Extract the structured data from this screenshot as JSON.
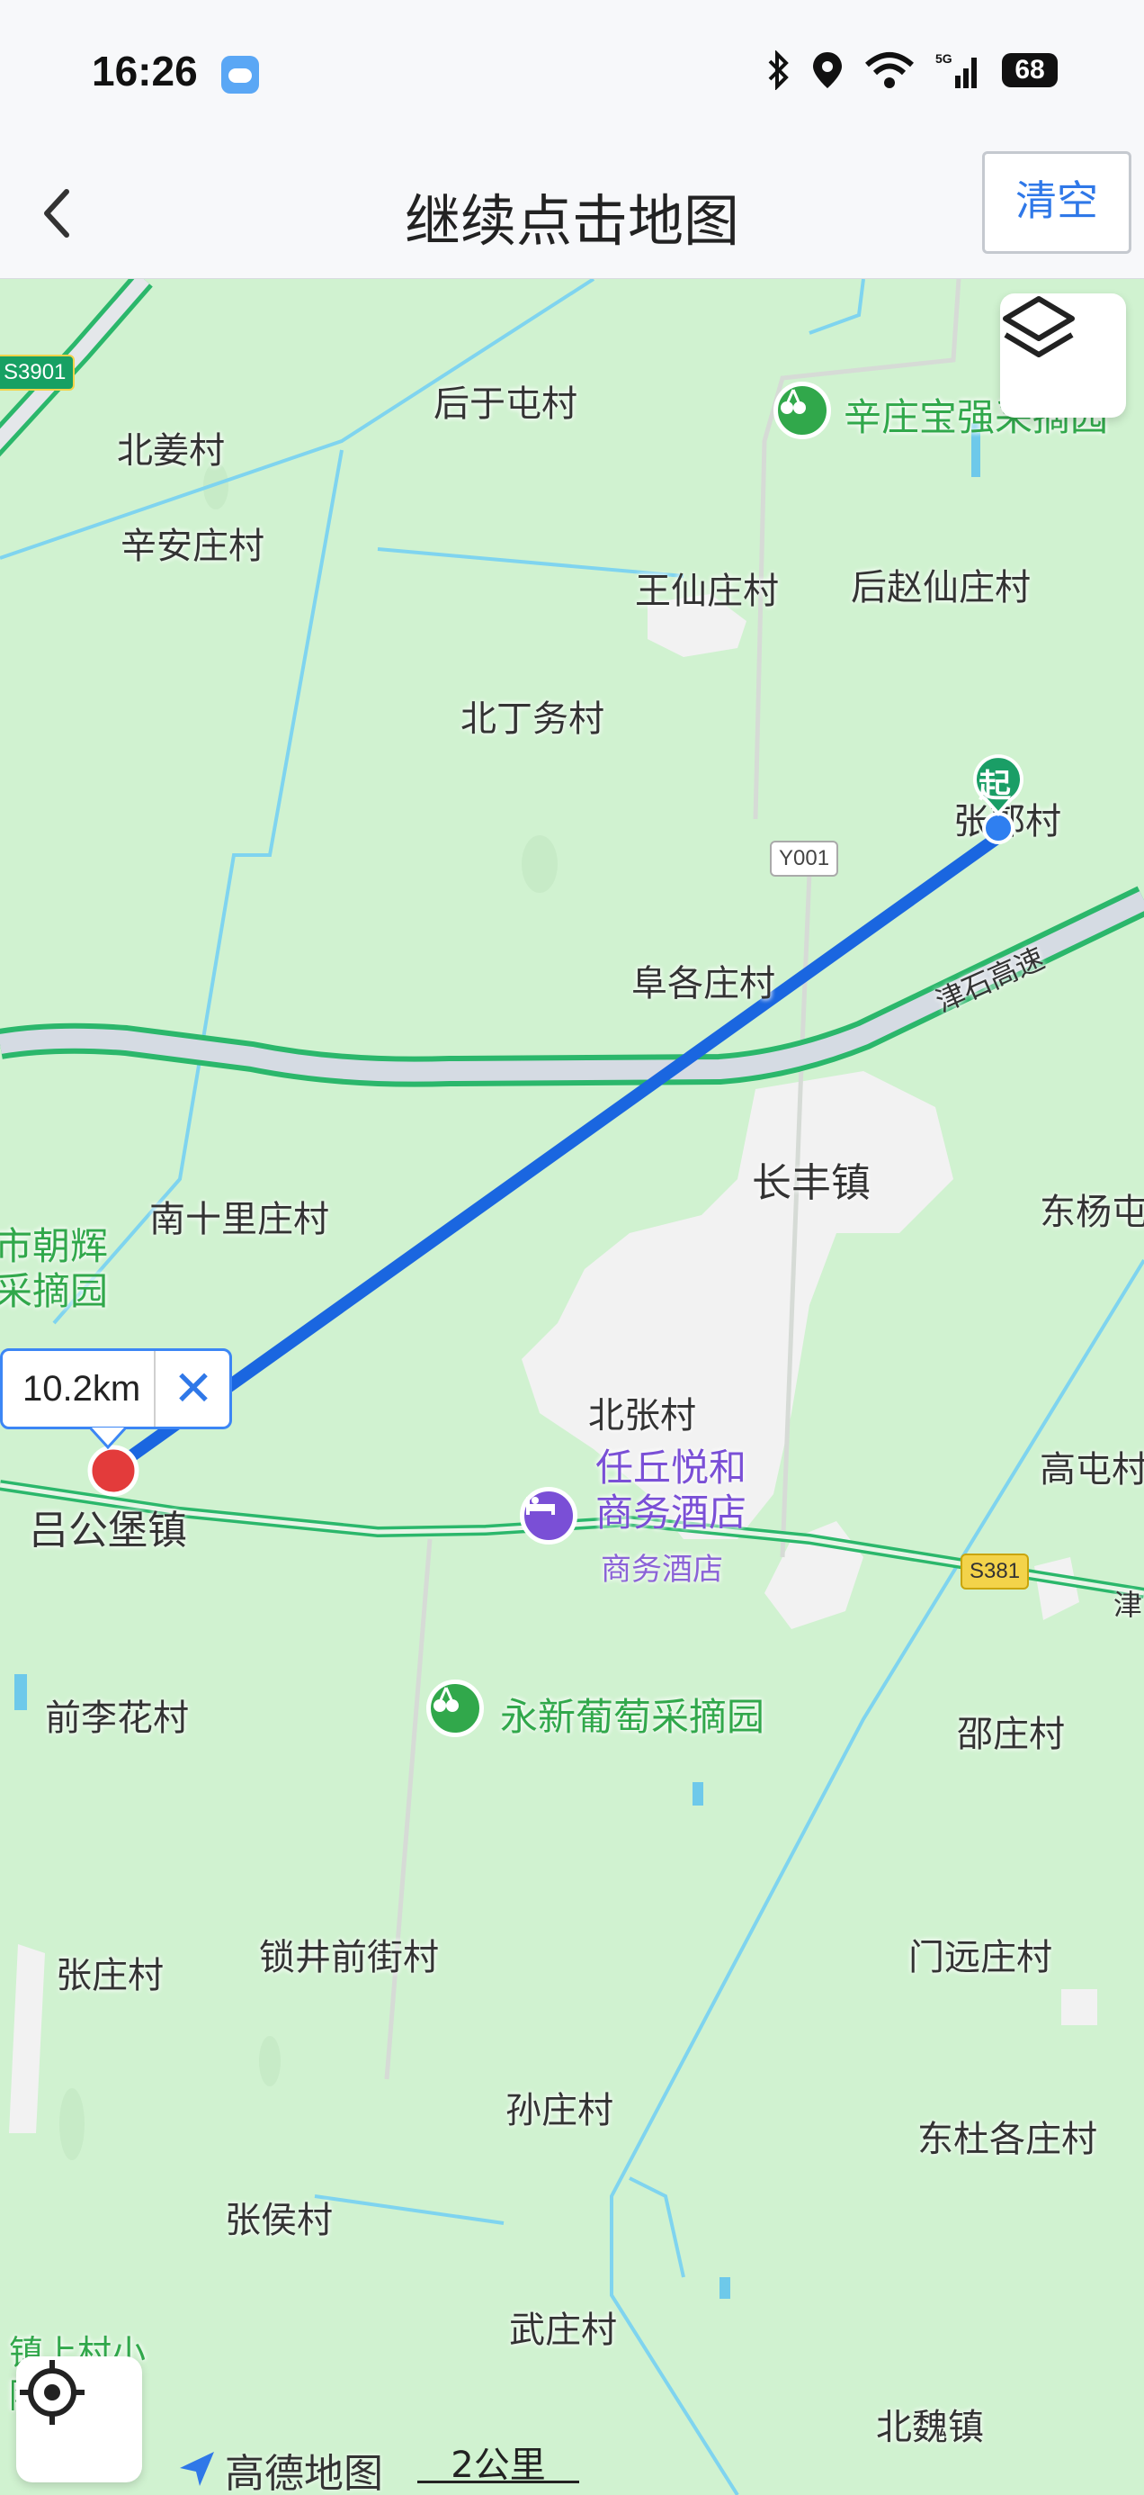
{
  "status_bar": {
    "time": "16:26",
    "battery": "68",
    "network": "5G"
  },
  "header": {
    "title": "继续点击地图",
    "clear_label": "清空"
  },
  "map": {
    "labels": {
      "houyutun": "后于屯村",
      "beijiang": "北姜村",
      "xinanzhuang": "辛安庄村",
      "xinzhuang_poi": "辛庄宝强采摘园",
      "wangxianzhuang": "王仙庄村",
      "houzhaoxianzhuang": "后赵仙庄村",
      "beidingwu": "北丁务村",
      "zhangzhuang_top": "张郭村",
      "fugezhuang": "阜各庄村",
      "changfeng": "长丰镇",
      "nanshilizhuang": "南十里庄村",
      "chaohui": "市朝辉\n采摘园",
      "dongyang": "东杨屯",
      "beizhang": "北张村",
      "hotel_name": "任丘悦和\n商务酒店",
      "hotel_sub": "商务酒店",
      "gaotun": "高屯村",
      "lvgongbao": "吕公堡镇",
      "qianlihua": "前李花村",
      "yongxin_poi": "永新葡萄采摘园",
      "shaozhuang": "邵庄村",
      "zhangzhuang": "张庄村",
      "suojingqianjie": "锁井前街村",
      "menyuanzhuang": "门远庄村",
      "sunzhuang": "孙庄村",
      "dongdugezhuang": "东杜各庄村",
      "zhanghou": "张侯村",
      "wuzhuang": "武庄村",
      "beiwei": "北魏镇",
      "zhenshang": "镇上村小\n院",
      "jinshi": "津石高速",
      "jin_right": "津"
    },
    "road_badges": {
      "s3901": "S3901",
      "y001": "Y001",
      "s381": "S381"
    },
    "start_marker": "起",
    "distance": "10.2km",
    "distance_close": "✕",
    "logo": "高德地图",
    "scale": "2公里"
  },
  "colors": {
    "accent": "#2f78e8",
    "route": "#1a66e0",
    "poi_green": "#31a84b",
    "poi_purple": "#7a4fd6",
    "start_marker": "#1a9e66",
    "end_marker": "#e33b3b"
  }
}
